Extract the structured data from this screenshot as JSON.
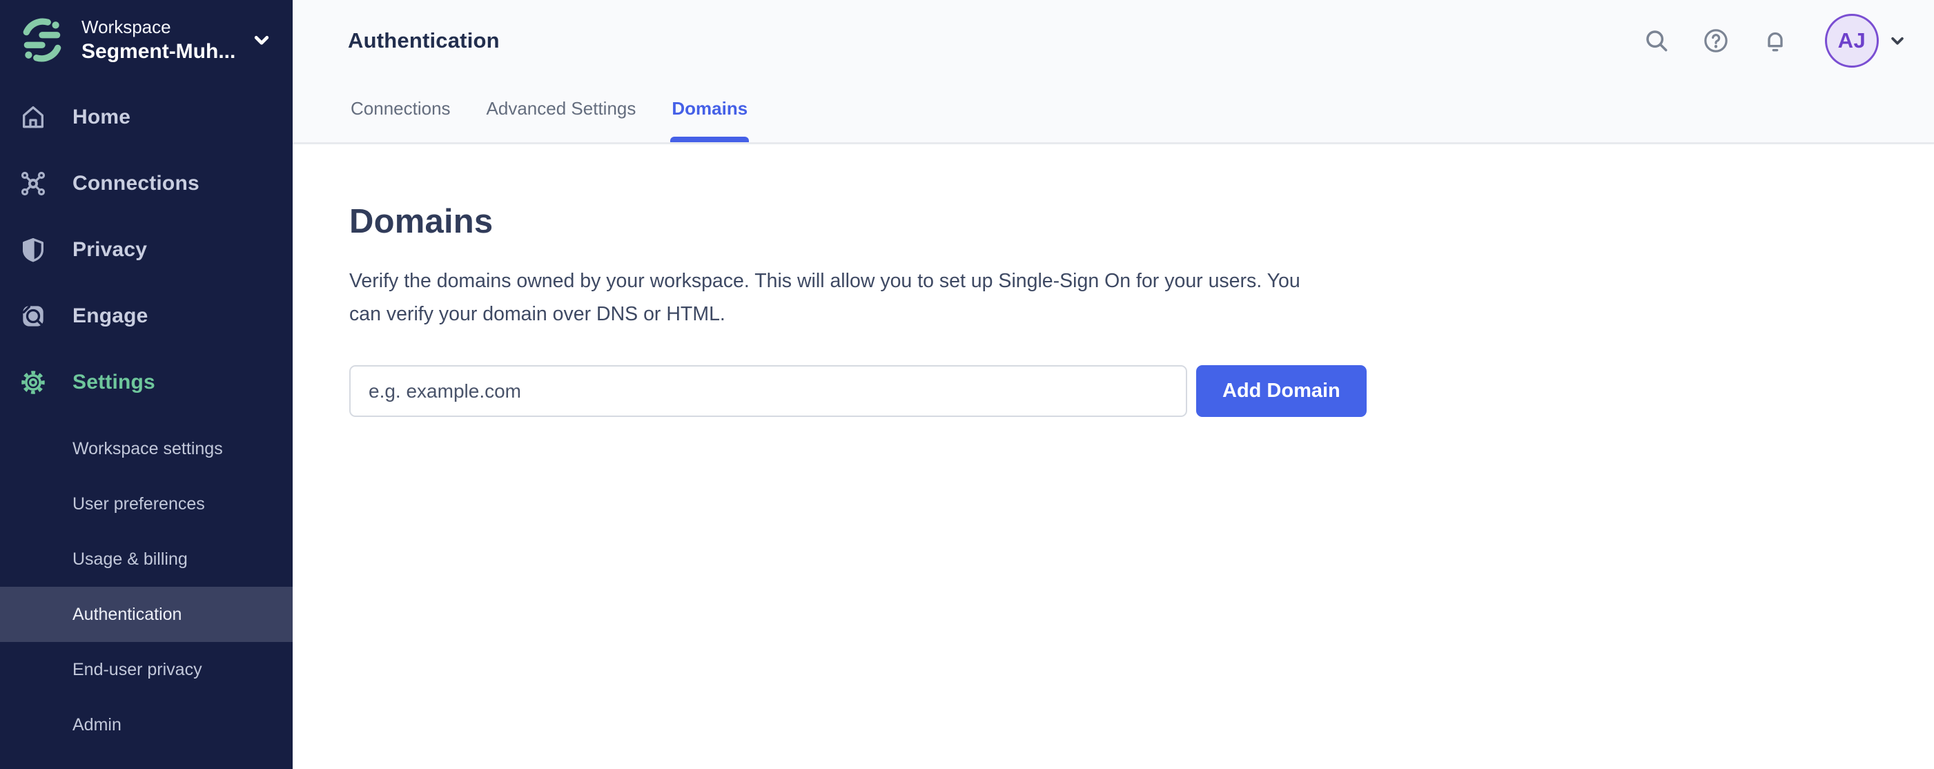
{
  "sidebar": {
    "workspace_label": "Workspace",
    "workspace_name": "Segment-Muh...",
    "items": [
      {
        "label": "Home",
        "icon": "home-icon"
      },
      {
        "label": "Connections",
        "icon": "connections-icon"
      },
      {
        "label": "Privacy",
        "icon": "shield-icon"
      },
      {
        "label": "Engage",
        "icon": "engage-icon"
      },
      {
        "label": "Settings",
        "icon": "gear-icon"
      }
    ],
    "subitems": [
      "Workspace settings",
      "User preferences",
      "Usage & billing",
      "Authentication",
      "End-user privacy",
      "Admin"
    ],
    "active_item": "Settings",
    "active_subitem": "Authentication"
  },
  "header": {
    "title": "Authentication",
    "tabs": [
      {
        "label": "Connections",
        "active": false
      },
      {
        "label": "Advanced Settings",
        "active": false
      },
      {
        "label": "Domains",
        "active": true
      }
    ],
    "avatar_initials": "AJ"
  },
  "main": {
    "heading": "Domains",
    "description_line1": "Verify the domains owned by your workspace. This will allow you to set up Single-Sign On for your users. You",
    "description_line2": "can verify your domain over DNS or HTML.",
    "domain_input_placeholder": "e.g. example.com",
    "add_domain_button": "Add Domain"
  },
  "colors": {
    "sidebar_bg": "#161e42",
    "sidebar_highlight": "#3a4161",
    "brand_green": "#6fc79c",
    "logo_green": "#86cba8",
    "tab_active_blue": "#4560e7",
    "button_blue": "#4463e8",
    "avatar_purple": "#7a4ed2",
    "avatar_bg": "#eae4f9",
    "header_bg": "#f9fafc",
    "divider": "#e8eaee",
    "title_navy": "#222e4e",
    "text_slate": "#3e4963"
  }
}
